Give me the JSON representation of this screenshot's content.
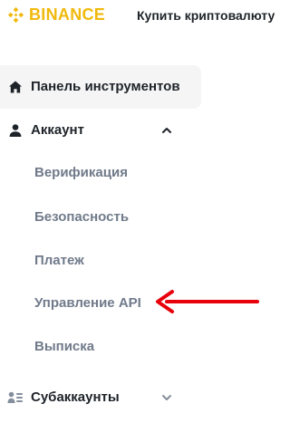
{
  "header": {
    "logo_text": "BINANCE",
    "brand_color": "#F0B90B",
    "buy_crypto_label": "Купить криптовалюту"
  },
  "sidebar": {
    "dashboard": {
      "label": "Панель инструментов",
      "icon": "home-icon",
      "active": true
    },
    "account": {
      "label": "Аккаунт",
      "icon": "user-icon",
      "expanded": true,
      "chevron": "chevron-up-icon",
      "items": [
        {
          "label": "Верификация"
        },
        {
          "label": "Безопасность"
        },
        {
          "label": "Платеж"
        },
        {
          "label": "Управление API",
          "highlighted_by_arrow": true
        },
        {
          "label": "Выписка"
        }
      ]
    },
    "subaccounts": {
      "label": "Субаккаунты",
      "icon": "subaccounts-icon",
      "expanded": false,
      "chevron": "chevron-down-icon"
    }
  },
  "annotation": {
    "icon": "red-arrow-icon",
    "color": "#E8000B"
  },
  "colors": {
    "text_primary": "#1E2329",
    "text_secondary": "#707A8A",
    "active_bg": "#F5F5F5"
  }
}
